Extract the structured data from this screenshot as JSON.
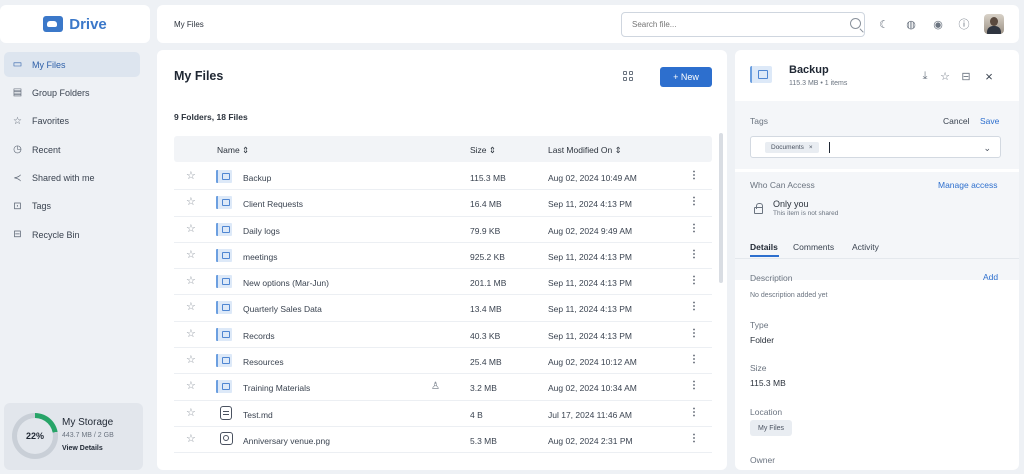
{
  "app": {
    "name": "Drive"
  },
  "nav": [
    {
      "label": "My Files",
      "icon": "folder-icon",
      "active": true
    },
    {
      "label": "Group Folders",
      "icon": "group-folder-icon"
    },
    {
      "label": "Favorites",
      "icon": "star-icon"
    },
    {
      "label": "Recent",
      "icon": "clock-icon"
    },
    {
      "label": "Shared with me",
      "icon": "share-icon"
    },
    {
      "label": "Tags",
      "icon": "tag-icon"
    },
    {
      "label": "Recycle Bin",
      "icon": "trash-icon"
    }
  ],
  "storage": {
    "title": "My Storage",
    "percent_label": "22%",
    "percent": 22,
    "used": "443.7 MB / 2 GB",
    "link": "View Details"
  },
  "topbar": {
    "breadcrumb": "My Files",
    "search_placeholder": "Search file..."
  },
  "main": {
    "title": "My Files",
    "new_label": "+ New",
    "count": "9 Folders, 18 Files",
    "columns": {
      "name": "Name  ⇕",
      "size": "Size  ⇕",
      "modified": "Last Modified On  ⇕"
    },
    "rows": [
      {
        "name": "Backup",
        "size": "115.3 MB",
        "modified": "Aug 02, 2024 10:49 AM",
        "type": "folder"
      },
      {
        "name": "Client Requests",
        "size": "16.4 MB",
        "modified": "Sep 11, 2024 4:13 PM",
        "type": "folder"
      },
      {
        "name": "Daily logs",
        "size": "79.9 KB",
        "modified": "Aug 02, 2024 9:49 AM",
        "type": "folder"
      },
      {
        "name": "meetings",
        "size": "925.2 KB",
        "modified": "Sep 11, 2024 4:13 PM",
        "type": "folder"
      },
      {
        "name": "New options (Mar-Jun)",
        "size": "201.1 MB",
        "modified": "Sep 11, 2024 4:13 PM",
        "type": "folder"
      },
      {
        "name": "Quarterly Sales Data",
        "size": "13.4 MB",
        "modified": "Sep 11, 2024 4:13 PM",
        "type": "folder"
      },
      {
        "name": "Records",
        "size": "40.3 KB",
        "modified": "Sep 11, 2024 4:13 PM",
        "type": "folder"
      },
      {
        "name": "Resources",
        "size": "25.4 MB",
        "modified": "Aug 02, 2024 10:12 AM",
        "type": "folder"
      },
      {
        "name": "Training Materials",
        "size": "3.2 MB",
        "modified": "Aug 02, 2024 10:34 AM",
        "type": "folder",
        "shared": true
      },
      {
        "name": "Test.md",
        "size": "4 B",
        "modified": "Jul 17, 2024 11:46 AM",
        "type": "doc"
      },
      {
        "name": "Anniversary venue.png",
        "size": "5.3 MB",
        "modified": "Aug 02, 2024 2:31 PM",
        "type": "image"
      }
    ]
  },
  "details": {
    "name": "Backup",
    "meta": "115.3 MB • 1 items",
    "tags_label": "Tags",
    "cancel": "Cancel",
    "save": "Save",
    "tag_chip": "Documents",
    "who_label": "Who Can Access",
    "manage": "Manage access",
    "only_you": "Only you",
    "not_shared": "This item is not shared",
    "tabs": [
      "Details",
      "Comments",
      "Activity"
    ],
    "description_label": "Description",
    "add": "Add",
    "description_value": "No description added yet",
    "type_label": "Type",
    "type_value": "Folder",
    "size_label": "Size",
    "size_value": "115.3 MB",
    "location_label": "Location",
    "location_value": "My Files",
    "owner_label": "Owner"
  }
}
